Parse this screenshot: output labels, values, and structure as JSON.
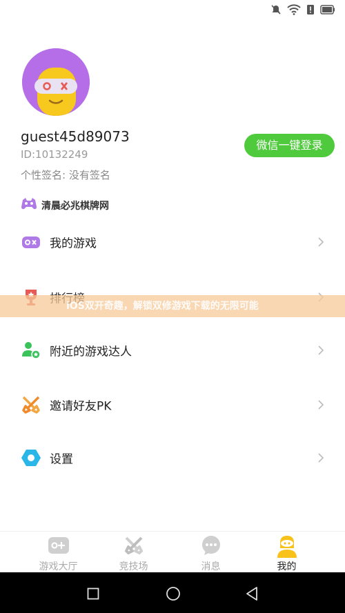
{
  "profile": {
    "username": "guest45d89073",
    "id_text": "ID:10132249",
    "signature": "个性签名: 没有签名",
    "login_button": "微信一键登录",
    "site_name": "清晨必兆棋牌网"
  },
  "menu": {
    "items": [
      {
        "label": "我的游戏",
        "icon": "gamepad-icon",
        "color": "#b07ae6"
      },
      {
        "label": "排行榜",
        "icon": "trophy-icon",
        "color": "#e85a55"
      },
      {
        "label": "附近的游戏达人",
        "icon": "nearby-people-icon",
        "color": "#3cc25b"
      },
      {
        "label": "邀请好友PK",
        "icon": "crossed-swords-icon",
        "color": "#f3a742"
      },
      {
        "label": "设置",
        "icon": "settings-hexagon-icon",
        "color": "#2bb6e8"
      }
    ]
  },
  "watermark": "iOS双开奇趣，解锁双修游戏下载的无限可能",
  "tabs": [
    {
      "label": "游戏大厅",
      "icon": "game-hall-icon",
      "active": false
    },
    {
      "label": "竞技场",
      "icon": "arena-icon",
      "active": false
    },
    {
      "label": "消息",
      "icon": "chat-icon",
      "active": false
    },
    {
      "label": "我的",
      "icon": "me-icon",
      "active": true
    }
  ],
  "colors": {
    "accent_green": "#4fca3c",
    "active_tab_yellow": "#f8c21a",
    "avatar_purple": "#b56ee8"
  }
}
